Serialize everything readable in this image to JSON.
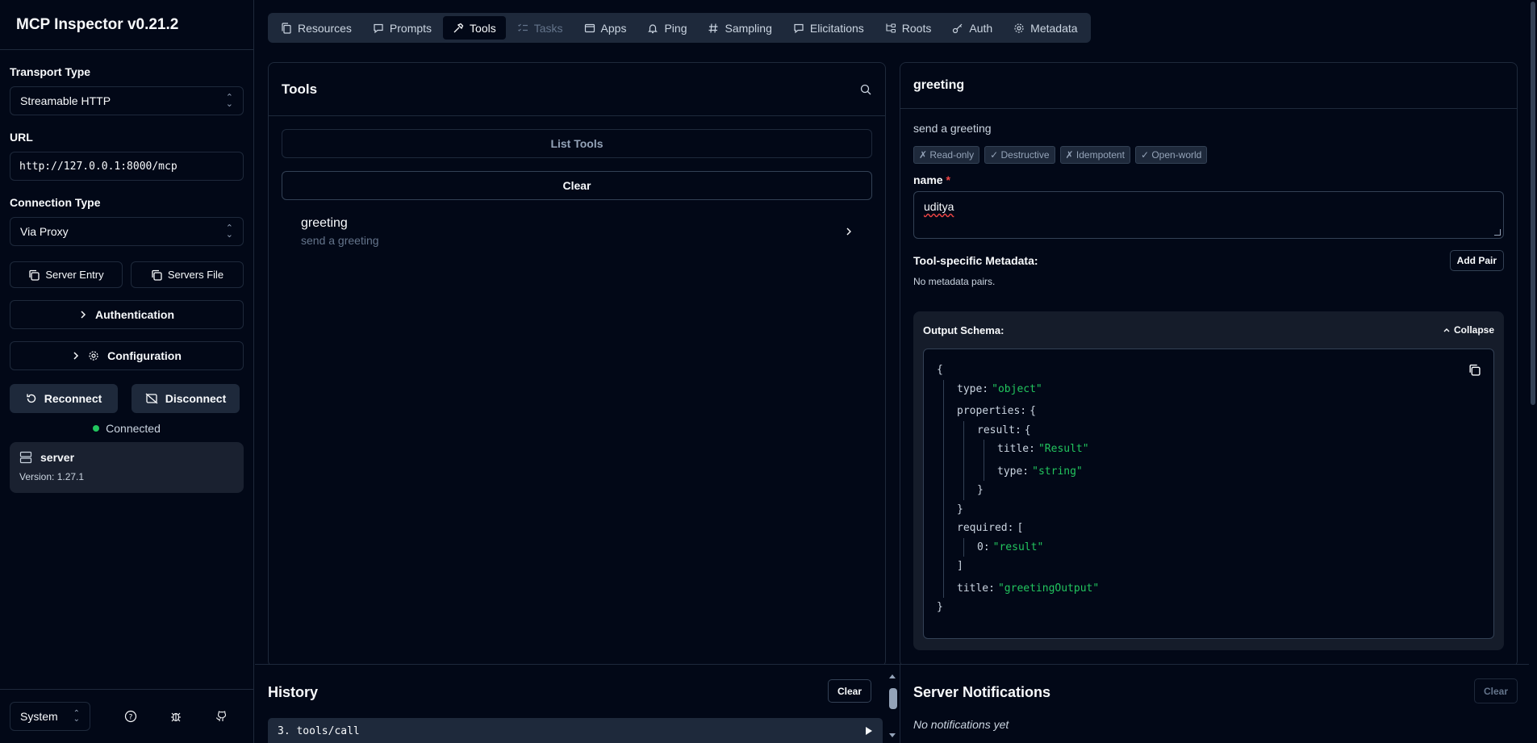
{
  "app": {
    "title": "MCP Inspector v0.21.2"
  },
  "sidebar": {
    "transport_label": "Transport Type",
    "transport_value": "Streamable HTTP",
    "url_label": "URL",
    "url_value": "http://127.0.0.1:8000/mcp",
    "connection_label": "Connection Type",
    "connection_value": "Via Proxy",
    "server_entry": "Server Entry",
    "servers_file": "Servers File",
    "authentication": "Authentication",
    "configuration": "Configuration",
    "reconnect": "Reconnect",
    "disconnect": "Disconnect",
    "status": "Connected",
    "status_color": "#22c55e",
    "server_name": "server",
    "server_version": "Version: 1.27.1",
    "theme": "System"
  },
  "tabs": [
    {
      "label": "Resources",
      "icon": "files-icon"
    },
    {
      "label": "Prompts",
      "icon": "message-icon"
    },
    {
      "label": "Tools",
      "icon": "hammer-icon",
      "active": true
    },
    {
      "label": "Tasks",
      "icon": "list-checks-icon",
      "disabled": true
    },
    {
      "label": "Apps",
      "icon": "app-window-icon"
    },
    {
      "label": "Ping",
      "icon": "bell-icon"
    },
    {
      "label": "Sampling",
      "icon": "hash-icon"
    },
    {
      "label": "Elicitations",
      "icon": "message-square-icon"
    },
    {
      "label": "Roots",
      "icon": "folder-tree-icon"
    },
    {
      "label": "Auth",
      "icon": "key-icon"
    },
    {
      "label": "Metadata",
      "icon": "gear-icon"
    }
  ],
  "tools_panel": {
    "title": "Tools",
    "list_button": "List Tools",
    "clear_button": "Clear",
    "items": [
      {
        "name": "greeting",
        "description": "send a greeting"
      }
    ]
  },
  "detail": {
    "title": "greeting",
    "description": "send a greeting",
    "badges": [
      "✗ Read-only",
      "✓ Destructive",
      "✗ Idempotent",
      "✓ Open-world"
    ],
    "field_label": "name",
    "field_required": "*",
    "field_value": "uditya",
    "metadata_title": "Tool-specific Metadata:",
    "add_pair": "Add Pair",
    "no_metadata": "No metadata pairs.",
    "schema_title": "Output Schema:",
    "collapse": "Collapse"
  },
  "schema": {
    "open": "{",
    "type_key": "type:",
    "type_val": "\"object\"",
    "properties_key": "properties:",
    "brace_open": "{",
    "result_key": "result:",
    "title_key": "title:",
    "title_val": "\"Result\"",
    "type2_key": "type:",
    "type2_val": "\"string\"",
    "brace_close": "}",
    "required_key": "required:",
    "bracket_open": "[",
    "idx_key": "0:",
    "idx_val": "\"result\"",
    "bracket_close": "]",
    "title2_key": "title:",
    "title2_val": "\"greetingOutput\"",
    "close": "}"
  },
  "history": {
    "title": "History",
    "clear": "Clear",
    "item": "3. tools/call"
  },
  "notifications": {
    "title": "Server Notifications",
    "clear": "Clear",
    "empty": "No notifications yet"
  }
}
